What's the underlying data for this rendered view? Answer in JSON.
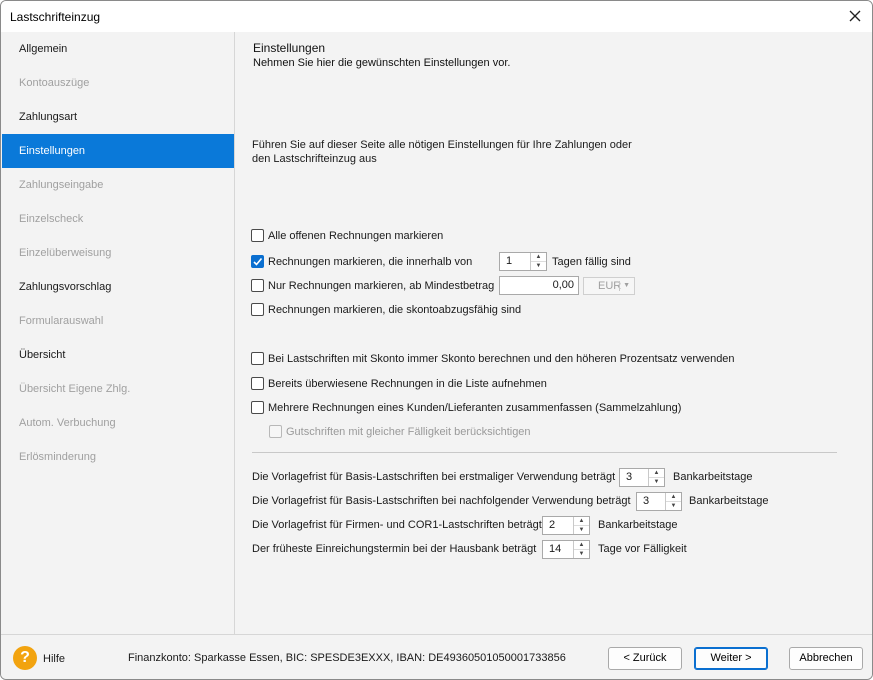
{
  "window": {
    "title": "Lastschrifteinzug"
  },
  "sidebar": {
    "items": [
      {
        "label": "Allgemein",
        "state": "enabled"
      },
      {
        "label": "Kontoauszüge",
        "state": "disabled"
      },
      {
        "label": "Zahlungsart",
        "state": "enabled"
      },
      {
        "label": "Einstellungen",
        "state": "active"
      },
      {
        "label": "Zahlungseingabe",
        "state": "disabled"
      },
      {
        "label": "Einzelscheck",
        "state": "disabled"
      },
      {
        "label": "Einzelüberweisung",
        "state": "disabled"
      },
      {
        "label": "Zahlungsvorschlag",
        "state": "enabled"
      },
      {
        "label": "Formularauswahl",
        "state": "disabled"
      },
      {
        "label": "Übersicht",
        "state": "enabled"
      },
      {
        "label": "Übersicht Eigene Zhlg.",
        "state": "disabled"
      },
      {
        "label": "Autom. Verbuchung",
        "state": "disabled"
      },
      {
        "label": "Erlösminderung",
        "state": "disabled"
      }
    ]
  },
  "main": {
    "heading": "Einstellungen",
    "subheading": "Nehmen Sie hier die gewünschten Einstellungen vor.",
    "intro_line1": "Führen Sie auf dieser Seite alle nötigen Einstellungen für Ihre Zahlungen oder",
    "intro_line2": "den Lastschrifteinzug aus",
    "options": {
      "mark_all_open": {
        "label": "Alle offenen Rechnungen markieren",
        "checked": false
      },
      "mark_due_within": {
        "label": "Rechnungen markieren, die innerhalb von",
        "checked": true,
        "days": "1",
        "suffix": "Tagen fällig sind"
      },
      "mark_min_amount": {
        "label": "Nur Rechnungen markieren, ab Mindestbetrag",
        "checked": false,
        "amount": "0,00",
        "currency": "EUR"
      },
      "mark_discount": {
        "label": "Rechnungen markieren, die skontoabzugsfähig sind",
        "checked": false
      },
      "always_discount": {
        "label": "Bei Lastschriften mit Skonto immer Skonto berechnen und den höheren Prozentsatz verwenden",
        "checked": false
      },
      "include_transferred": {
        "label": "Bereits überwiesene Rechnungen in die Liste aufnehmen",
        "checked": false
      },
      "combine_invoices": {
        "label": "Mehrere Rechnungen eines Kunden/Lieferanten zusammenfassen (Sammelzahlung)",
        "checked": false
      },
      "credit_notes": {
        "label": "Gutschriften mit gleicher Fälligkeit berücksichtigen",
        "checked": false,
        "disabled": true
      }
    },
    "periods": {
      "basis_first": {
        "label": "Die Vorlagefrist für Basis-Lastschriften bei erstmaliger Verwendung beträgt",
        "value": "3",
        "unit": "Bankarbeitstage"
      },
      "basis_following": {
        "label": "Die Vorlagefrist für Basis-Lastschriften bei nachfolgender Verwendung beträgt",
        "value": "3",
        "unit": "Bankarbeitstage"
      },
      "firm_cor1": {
        "label": "Die Vorlagefrist für Firmen- und COR1-Lastschriften beträgt",
        "value": "2",
        "unit": "Bankarbeitstage"
      },
      "earliest_submission": {
        "label": "Der früheste Einreichungstermin bei der Hausbank beträgt",
        "value": "14",
        "unit": "Tage vor Fälligkeit"
      }
    }
  },
  "footer": {
    "help_label": "Hilfe",
    "account_info": "Finanzkonto: Sparkasse Essen, BIC: SPESDE3EXXX, IBAN: DE49360501050001733856",
    "back_label": "< Zurück",
    "next_label": "Weiter >",
    "cancel_label": "Abbrechen"
  },
  "colors": {
    "accent": "#0a79d9",
    "help_icon": "#f2a30f"
  }
}
